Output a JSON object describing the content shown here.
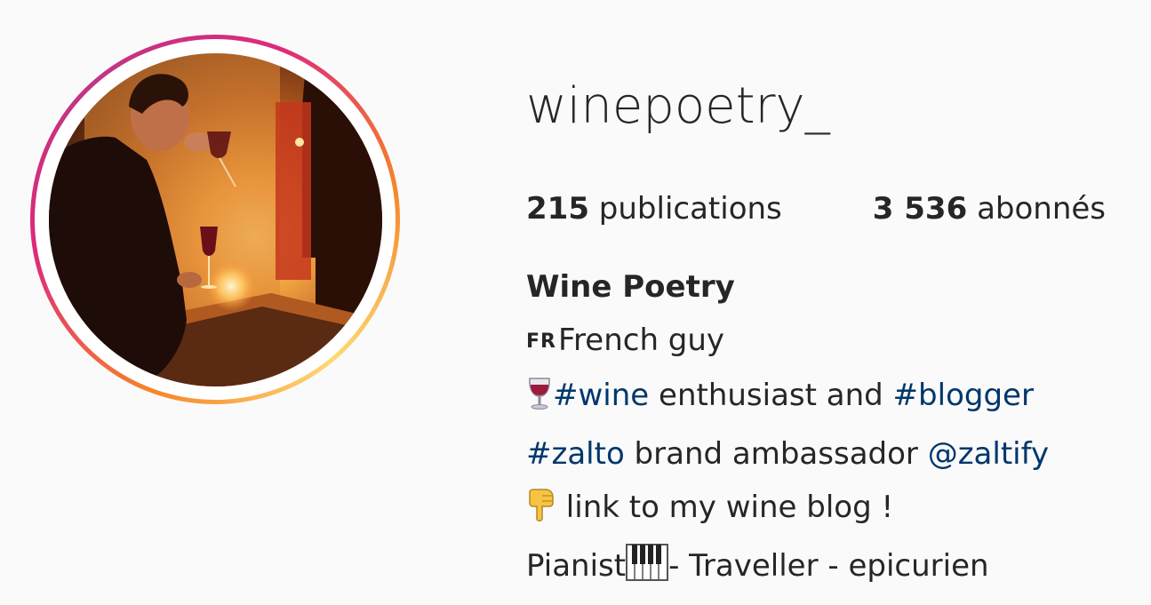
{
  "profile": {
    "username": "winepoetry_",
    "avatar_icon": "profile-photo",
    "ring_colors": [
      "#f58529",
      "#dd2a7b",
      "#c13584"
    ]
  },
  "stats": {
    "posts_count": "215",
    "posts_label": "publications",
    "followers_count": "3 536",
    "followers_label": "abonnés"
  },
  "bio": {
    "full_name": "Wine Poetry",
    "line1": {
      "flag": "FR",
      "text": "French guy"
    },
    "line2": {
      "emoji": "wine-glass-emoji",
      "tag1": "#wine",
      "text1": " enthusiast and ",
      "tag2": "#blogger"
    },
    "line3": {
      "tag": "#zalto",
      "text": " brand ambassador ",
      "mention": "@zaltify"
    },
    "line4": {
      "emoji": "pointing-down-emoji",
      "text": " link to my wine blog !"
    },
    "line5": {
      "text1": "Pianist",
      "emoji": "piano-keys-emoji",
      "text2": "- Traveller - epicurien"
    }
  },
  "colors": {
    "link": "#00376b",
    "text": "#262626",
    "background": "#fafafa"
  }
}
